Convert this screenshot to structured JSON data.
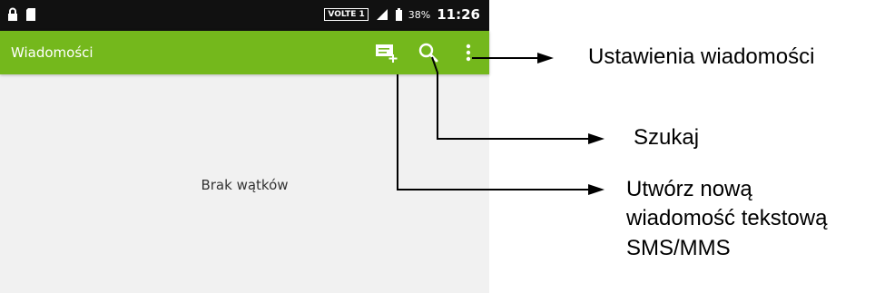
{
  "statusbar": {
    "volte": "VOLTE 1",
    "battery": "38%",
    "time": "11:26"
  },
  "appbar": {
    "title": "Wiadomości",
    "icons": [
      "new-message-icon",
      "search-icon",
      "more-vert-icon"
    ]
  },
  "content": {
    "empty_text": "Brak wątków"
  },
  "annotations": {
    "settings": "Ustawienia wiadomości",
    "search": "Szukaj",
    "new_message_line1": "Utwórz nową",
    "new_message_line2": "wiadomość tekstową",
    "new_message_line3": "SMS/MMS"
  },
  "colors": {
    "appbar": "#74b81c",
    "statusbar": "#111111",
    "background": "#f1f1f1"
  }
}
